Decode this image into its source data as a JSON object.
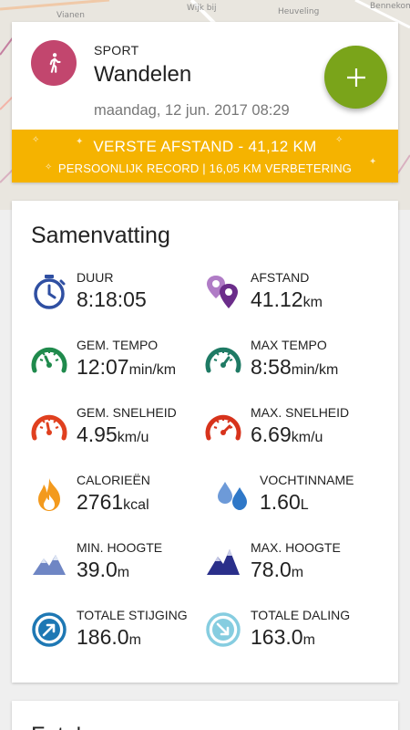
{
  "map": {
    "labels": [
      "Wijk bij",
      "Heuveling",
      "Bennekom",
      "Vianen"
    ]
  },
  "header": {
    "kicker": "SPORT",
    "sport": "Wandelen",
    "date": "maandag, 12 jun. 2017 08:29",
    "avatar_icon": "walking-person-icon",
    "avatar_color": "#c2466e",
    "fab_icon": "plus-icon",
    "fab_color": "#7aa41a"
  },
  "record": {
    "title": "VERSTE AFSTAND  -  41,12 KM",
    "subtitle": "PERSOONLIJK RECORD  |  16,05 KM VERBETERING",
    "color": "#f5b300"
  },
  "summary": {
    "title": "Samenvatting",
    "stats": [
      {
        "label": "DUUR",
        "value": "8:18:05",
        "unit": "",
        "icon": "stopwatch-icon"
      },
      {
        "label": "AFSTAND",
        "value": "41.12",
        "unit": "km",
        "icon": "map-pins-icon"
      },
      {
        "label": "GEM. TEMPO",
        "value": "12:07",
        "unit": "min/km",
        "icon": "gauge-green-icon"
      },
      {
        "label": "MAX TEMPO",
        "value": "8:58",
        "unit": "min/km",
        "icon": "gauge-green-max-icon"
      },
      {
        "label": "GEM. SNELHEID",
        "value": "4.95",
        "unit": "km/u",
        "icon": "gauge-red-icon"
      },
      {
        "label": "MAX. SNELHEID",
        "value": "6.69",
        "unit": "km/u",
        "icon": "gauge-red-max-icon"
      },
      {
        "label": "CALORIEËN",
        "value": "2761",
        "unit": "kcal",
        "icon": "flame-icon"
      },
      {
        "label": "VOCHTINNAME",
        "value": "1.60",
        "unit": "L",
        "icon": "water-drops-icon"
      },
      {
        "label": "MIN. HOOGTE",
        "value": "39.0",
        "unit": "m",
        "icon": "mountain-light-icon"
      },
      {
        "label": "MAX. HOOGTE",
        "value": "78.0",
        "unit": "m",
        "icon": "mountain-dark-icon"
      },
      {
        "label": "TOTALE STIJGING",
        "value": "186.0",
        "unit": "m",
        "icon": "arrow-up-right-circle-icon"
      },
      {
        "label": "TOTALE DALING",
        "value": "163.0",
        "unit": "m",
        "icon": "arrow-down-right-circle-icon"
      }
    ]
  },
  "next_section": {
    "title": "Foto's"
  }
}
